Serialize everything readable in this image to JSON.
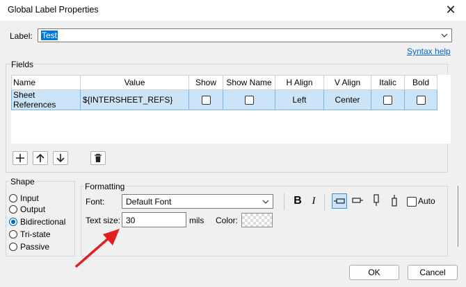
{
  "window": {
    "title": "Global Label Properties",
    "close_glyph": "✕"
  },
  "label": {
    "caption": "Label:",
    "value": "Test",
    "syntax_help": "Syntax help"
  },
  "fields": {
    "group_title": "Fields",
    "columns": [
      "Name",
      "Value",
      "Show",
      "Show Name",
      "H Align",
      "V Align",
      "Italic",
      "Bold"
    ],
    "rows": [
      {
        "name": "Sheet References",
        "value": "${INTERSHEET_REFS}",
        "show": false,
        "show_name": false,
        "h_align": "Left",
        "v_align": "Center",
        "italic": false,
        "bold": false
      }
    ],
    "toolbar_icons": [
      "add-icon",
      "move-up-icon",
      "move-down-icon",
      "delete-icon"
    ]
  },
  "shape": {
    "group_title": "Shape",
    "options": [
      "Input",
      "Output",
      "Bidirectional",
      "Tri-state",
      "Passive"
    ],
    "selected": "Bidirectional"
  },
  "formatting": {
    "group_title": "Formatting",
    "font_label": "Font:",
    "font_value": "Default Font",
    "bold_glyph": "B",
    "italic_glyph": "I",
    "auto_label": "Auto",
    "auto_checked": false,
    "text_size_label": "Text size:",
    "text_size_value": "30",
    "text_size_unit": "mils",
    "color_label": "Color:",
    "orientation_icons": [
      "orient-left-icon",
      "orient-right-icon",
      "orient-up-icon",
      "orient-down-icon"
    ],
    "selected_orientation": "orient-left-icon"
  },
  "buttons": {
    "ok": "OK",
    "cancel": "Cancel"
  },
  "colors": {
    "accent": "#0078d7",
    "selection_row": "#cce4f7",
    "arrow": "#e02020",
    "link": "#0066cc"
  }
}
